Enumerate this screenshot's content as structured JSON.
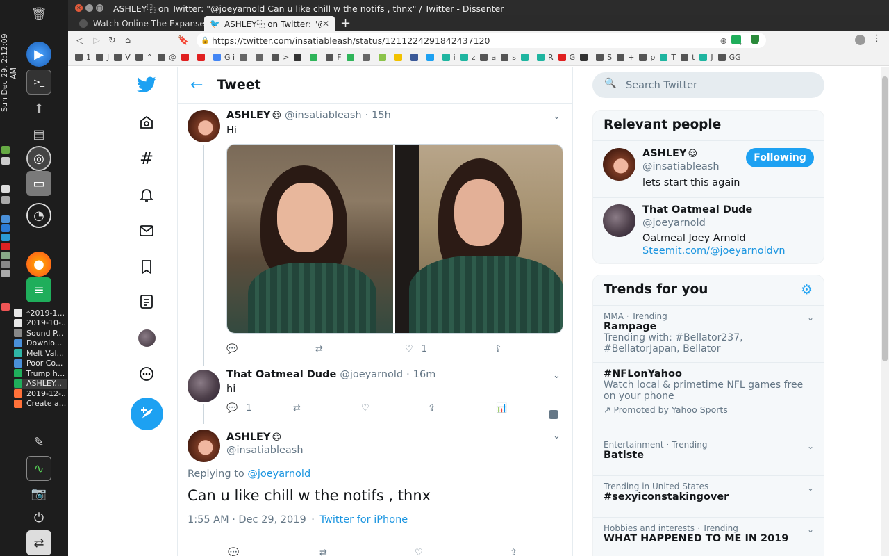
{
  "desktop": {
    "clock": "Sun Dec 29,  2:12:09 AM",
    "window_list": [
      {
        "label": "*2019-1...",
        "color": "#e8e8e8"
      },
      {
        "label": "2019-10-...",
        "color": "#e8e8e8"
      },
      {
        "label": "Sound P...",
        "color": "#888888"
      },
      {
        "label": "Downlo...",
        "color": "#4a90d9"
      },
      {
        "label": "Melt Val...",
        "color": "#2fb5a6"
      },
      {
        "label": "Poor Co...",
        "color": "#4a90d9"
      },
      {
        "label": "Trump h...",
        "color": "#1fae5b"
      },
      {
        "label": "ASHLEY...",
        "color": "#1fae5b"
      },
      {
        "label": "2019-12-...",
        "color": "#ff7139"
      },
      {
        "label": "Create a...",
        "color": "#ff7139"
      }
    ]
  },
  "browser": {
    "window_title": "ASHLEY⿻ on Twitter: \"@joeyarnold Can u like chill w the notifs , thnx\" / Twitter - Dissenter",
    "tabs": [
      {
        "label": "Watch Online The Expanse",
        "active": false
      },
      {
        "label": "ASHLEY⿻ on Twitter: \"@joe",
        "active": true
      }
    ],
    "new_tab": "+",
    "url": "https://twitter.com/insatiableash/status/1211224291842437120",
    "bookmarks": [
      {
        "label": "1",
        "color": "#555"
      },
      {
        "label": "J",
        "color": "#555"
      },
      {
        "label": "V",
        "color": "#555"
      },
      {
        "label": "^",
        "color": "#555"
      },
      {
        "label": "@",
        "color": "#555"
      },
      {
        "label": "",
        "color": "#e02020"
      },
      {
        "label": "",
        "color": "#e02020"
      },
      {
        "label": "G i",
        "color": "#4285f4"
      },
      {
        "label": "",
        "color": "#666"
      },
      {
        "label": "",
        "color": "#666"
      },
      {
        "label": ">",
        "color": "#555"
      },
      {
        "label": "",
        "color": "#333"
      },
      {
        "label": "",
        "color": "#2fb55a"
      },
      {
        "label": "F",
        "color": "#555"
      },
      {
        "label": "",
        "color": "#2fb55a"
      },
      {
        "label": "",
        "color": "#666"
      },
      {
        "label": "",
        "color": "#8bc34a"
      },
      {
        "label": "",
        "color": "#f2c200"
      },
      {
        "label": "",
        "color": "#3b5998"
      },
      {
        "label": "",
        "color": "#1da1f2"
      },
      {
        "label": "i",
        "color": "#1fb5a0"
      },
      {
        "label": "z",
        "color": "#1fb5a0"
      },
      {
        "label": "a",
        "color": "#555"
      },
      {
        "label": "s",
        "color": "#555"
      },
      {
        "label": "",
        "color": "#1fb5a0"
      },
      {
        "label": "R",
        "color": "#1fb5a0"
      },
      {
        "label": "G",
        "color": "#e02020"
      },
      {
        "label": "",
        "color": "#333"
      },
      {
        "label": "S",
        "color": "#555"
      },
      {
        "label": "+",
        "color": "#555"
      },
      {
        "label": "p",
        "color": "#555"
      },
      {
        "label": "T",
        "color": "#1fb5a0"
      },
      {
        "label": "t",
        "color": "#555"
      },
      {
        "label": "J",
        "color": "#1fb5a0"
      },
      {
        "label": "GG",
        "color": "#555"
      }
    ]
  },
  "nav": {
    "header_title": "Tweet"
  },
  "tweets": {
    "first": {
      "name": "ASHLEY",
      "emoji": "😌",
      "handle": "@insatiableash",
      "sep": "·",
      "time": "15h",
      "text": "Hi",
      "likes": "1"
    },
    "reply": {
      "name": "That Oatmeal Dude",
      "handle": "@joeyarnold",
      "sep": "·",
      "time": "16m",
      "text": "hi",
      "replies": "1"
    },
    "main": {
      "name": "ASHLEY",
      "emoji": "😌",
      "handle": "@insatiableash",
      "replying_prefix": "Replying to",
      "replying_to": "@joeyarnold",
      "text": "Can u like chill w the notifs , thnx",
      "timestamp": "1:55 AM · Dec 29, 2019",
      "sep": "·",
      "source": "Twitter for iPhone"
    }
  },
  "sidebar": {
    "search_placeholder": "Search Twitter",
    "relevant_title": "Relevant people",
    "people": [
      {
        "name": "ASHLEY",
        "emoji": "😌",
        "handle": "@insatiableash",
        "bio": "lets start this again",
        "button": "Following"
      },
      {
        "name": "That Oatmeal Dude",
        "handle": "@joeyarnold",
        "bio": "Oatmeal Joey Arnold",
        "link": "Steemit.com/@joeyarnoldvn"
      }
    ],
    "trends_title": "Trends for you",
    "trends": [
      {
        "meta": "MMA · Trending",
        "title": "Rampage",
        "sub": "Trending with: #Bellator237, #BellatorJapan, Bellator"
      },
      {
        "meta": "",
        "title": "#NFLonYahoo",
        "sub": "Watch local & primetime NFL games free on your phone",
        "promo": "Promoted by Yahoo Sports"
      },
      {
        "meta": "Entertainment · Trending",
        "title": "Batiste"
      },
      {
        "meta": "Trending in United States",
        "title": "#sexyiconstakingover"
      },
      {
        "meta": "Hobbies and interests · Trending",
        "title": "WHAT HAPPENED TO ME IN 2019"
      }
    ]
  },
  "colors": {
    "twitter_blue": "#1da1f2",
    "link_blue": "#1b95e0",
    "muted": "#657786"
  }
}
